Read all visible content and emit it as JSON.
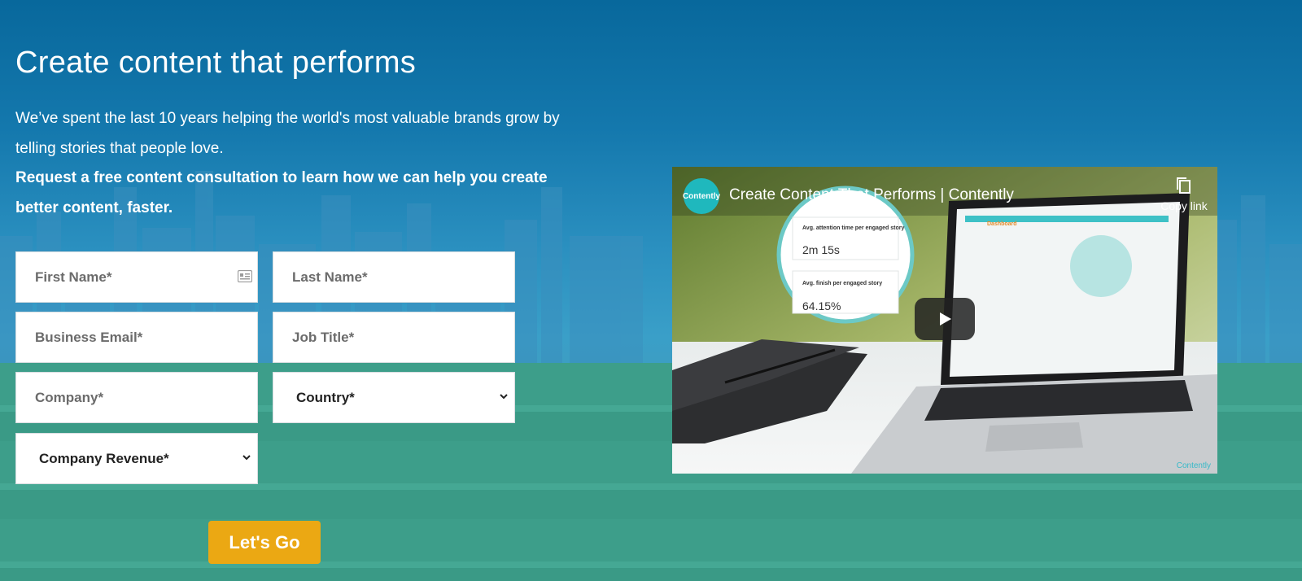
{
  "hero": {
    "headline": "Create content that performs",
    "intro": "We’ve spent the last 10 years helping the world's most valuable brands grow by telling stories that people love.",
    "intro_bold": "Request a free content consultation to learn how we can help you create better content, faster."
  },
  "form": {
    "first_name_placeholder": "First Name*",
    "last_name_placeholder": "Last Name*",
    "email_placeholder": "Business Email*",
    "job_title_placeholder": "Job Title*",
    "company_placeholder": "Company*",
    "country_label": "Country*",
    "revenue_label": "Company Revenue*",
    "submit_label": "Let's Go"
  },
  "video": {
    "channel_avatar_text": "Contently",
    "title": "Create Content That Performs | Contently",
    "copy_link_label": "Copy link",
    "watermark": "Contently",
    "screen": {
      "dashboard_title": "Dashboard",
      "metric1_label": "Avg. attention time per engaged story",
      "metric1_value": "2m 15s",
      "metric2_label": "Avg. finish per engaged story",
      "metric2_value": "64.15%"
    }
  },
  "colors": {
    "accent_button": "#eba813",
    "sky_top": "#08689c",
    "ground": "#3d9e8a",
    "brand_teal": "#1fb8bd"
  },
  "icons": {
    "contact_card": "contact-card-icon",
    "chevron": "chevron-down-icon",
    "copy": "copy-icon",
    "play": "play-icon"
  }
}
